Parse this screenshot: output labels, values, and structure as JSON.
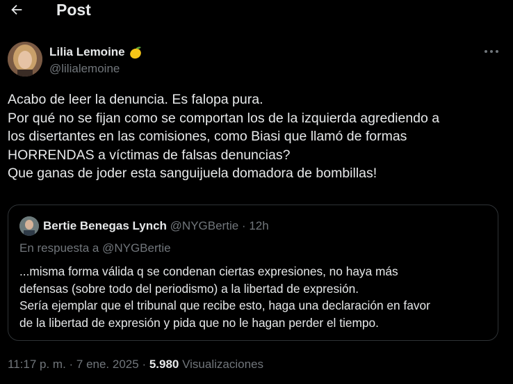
{
  "header": {
    "title": "Post",
    "back_icon": "arrow-left-icon"
  },
  "post": {
    "author": {
      "name": "Lilia Lemoine",
      "handle": "@lilialemoine",
      "badge_icon": "lemon-emoji-icon"
    },
    "text_lines": [
      "Acabo de leer la denuncia. Es falopa pura.",
      "Por qué no se fijan como se comportan los de la izquierda agrediendo a",
      "los disertantes en las comisiones, como Biasi que llamó de formas",
      "HORRENDAS a víctimas de falsas denuncias?",
      "Que ganas de joder esta sanguijuela domadora de bombillas!"
    ],
    "more_icon": "more-horizontal-icon"
  },
  "quote": {
    "name": "Bertie Benegas Lynch",
    "handle": "@NYGBertie",
    "separator": "·",
    "time": "12h",
    "reply_label": "En respuesta a @NYGBertie",
    "text_lines": [
      "...misma forma válida q se condenan ciertas expresiones, no haya más",
      "defensas (sobre todo del periodismo) a la libertad de expresión.",
      "Sería ejemplar que el tribunal que recibe esto, haga una declaración en favor",
      "de la libertad de expresión y pida que no le hagan perder el tiempo."
    ]
  },
  "meta": {
    "time": "11:17 p. m. · 7 ene. 2025",
    "separator": "·",
    "views_count": "5.980",
    "views_label": "Visualizaciones"
  },
  "colors": {
    "background": "#000000",
    "text": "#e7e9ea",
    "secondary": "#71767b",
    "border": "#2f3336"
  }
}
